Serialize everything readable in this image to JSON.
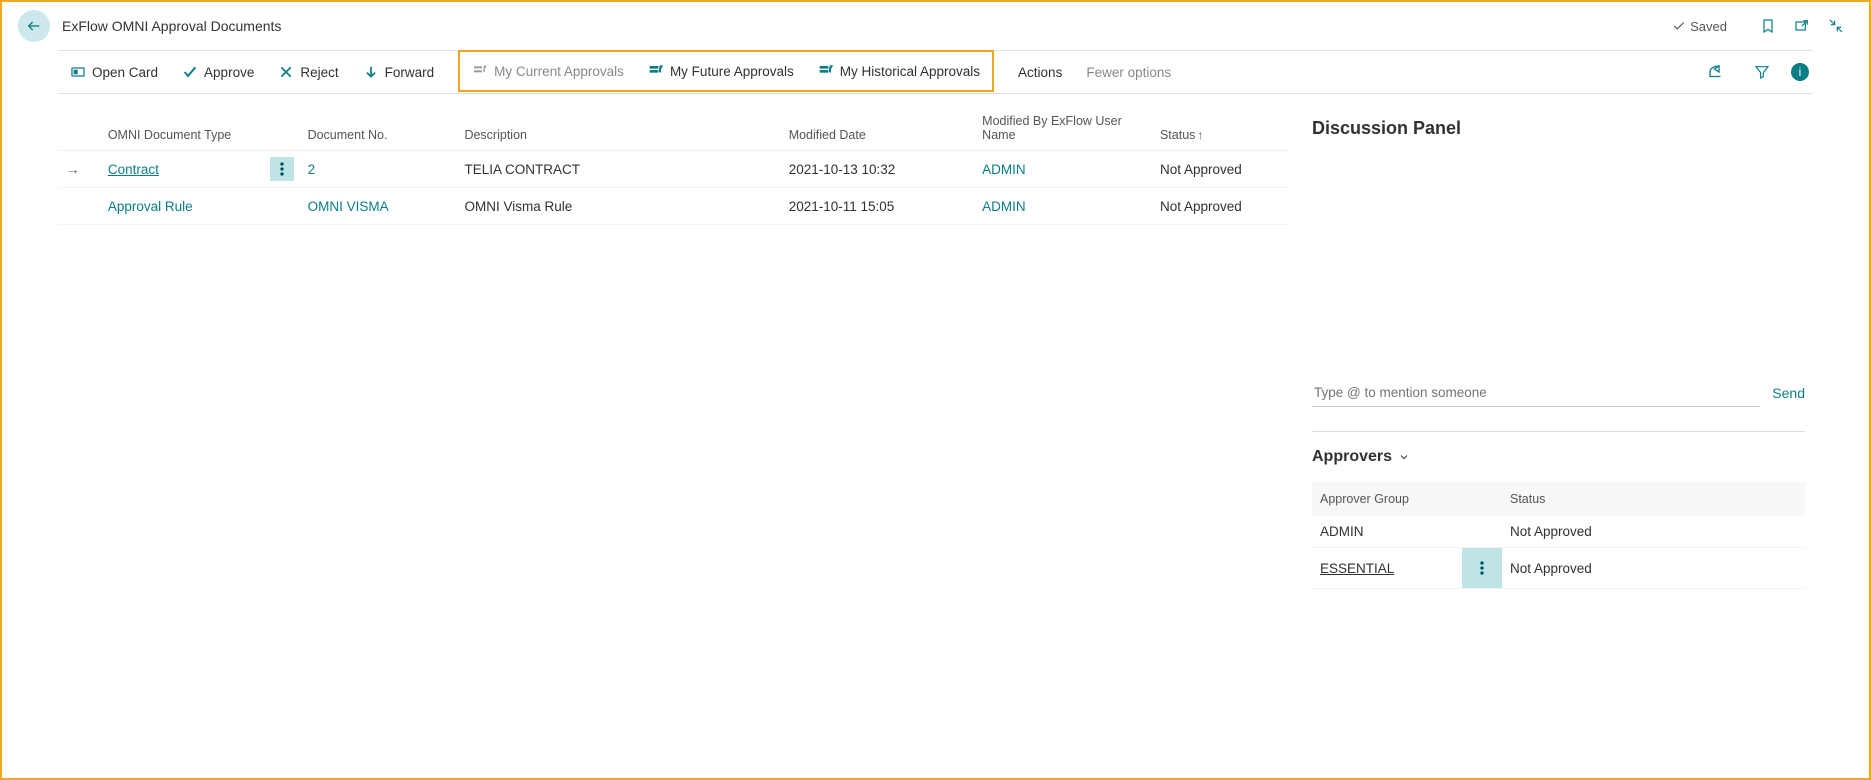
{
  "header": {
    "title": "ExFlow OMNI Approval Documents",
    "saved_label": "Saved"
  },
  "toolbar": {
    "open_card": "Open Card",
    "approve": "Approve",
    "reject": "Reject",
    "forward": "Forward",
    "my_current": "My Current Approvals",
    "my_future": "My Future Approvals",
    "my_historical": "My Historical Approvals",
    "actions": "Actions",
    "fewer_options": "Fewer options"
  },
  "table": {
    "columns": {
      "doc_type": "OMNI Document Type",
      "doc_no": "Document No.",
      "description": "Description",
      "modified_date": "Modified Date",
      "modified_by": "Modified By ExFlow User Name",
      "status": "Status",
      "status_sort_indicator": "↑"
    },
    "rows": [
      {
        "doc_type": "Contract",
        "doc_no": "2",
        "description": "TELIA CONTRACT",
        "modified_date": "2021-10-13 10:32",
        "modified_by": "ADMIN",
        "status": "Not Approved",
        "selected": true
      },
      {
        "doc_type": "Approval Rule",
        "doc_no": "OMNI VISMA",
        "description": "OMNI Visma Rule",
        "modified_date": "2021-10-11 15:05",
        "modified_by": "ADMIN",
        "status": "Not Approved",
        "selected": false
      }
    ]
  },
  "discussion": {
    "title": "Discussion Panel",
    "mention_placeholder": "Type @ to mention someone",
    "send_label": "Send"
  },
  "approvers": {
    "title": "Approvers",
    "columns": {
      "group": "Approver Group",
      "status": "Status"
    },
    "rows": [
      {
        "group": "ADMIN",
        "status": "Not Approved",
        "selected": false
      },
      {
        "group": "ESSENTIAL",
        "status": "Not Approved",
        "selected": true
      }
    ]
  }
}
